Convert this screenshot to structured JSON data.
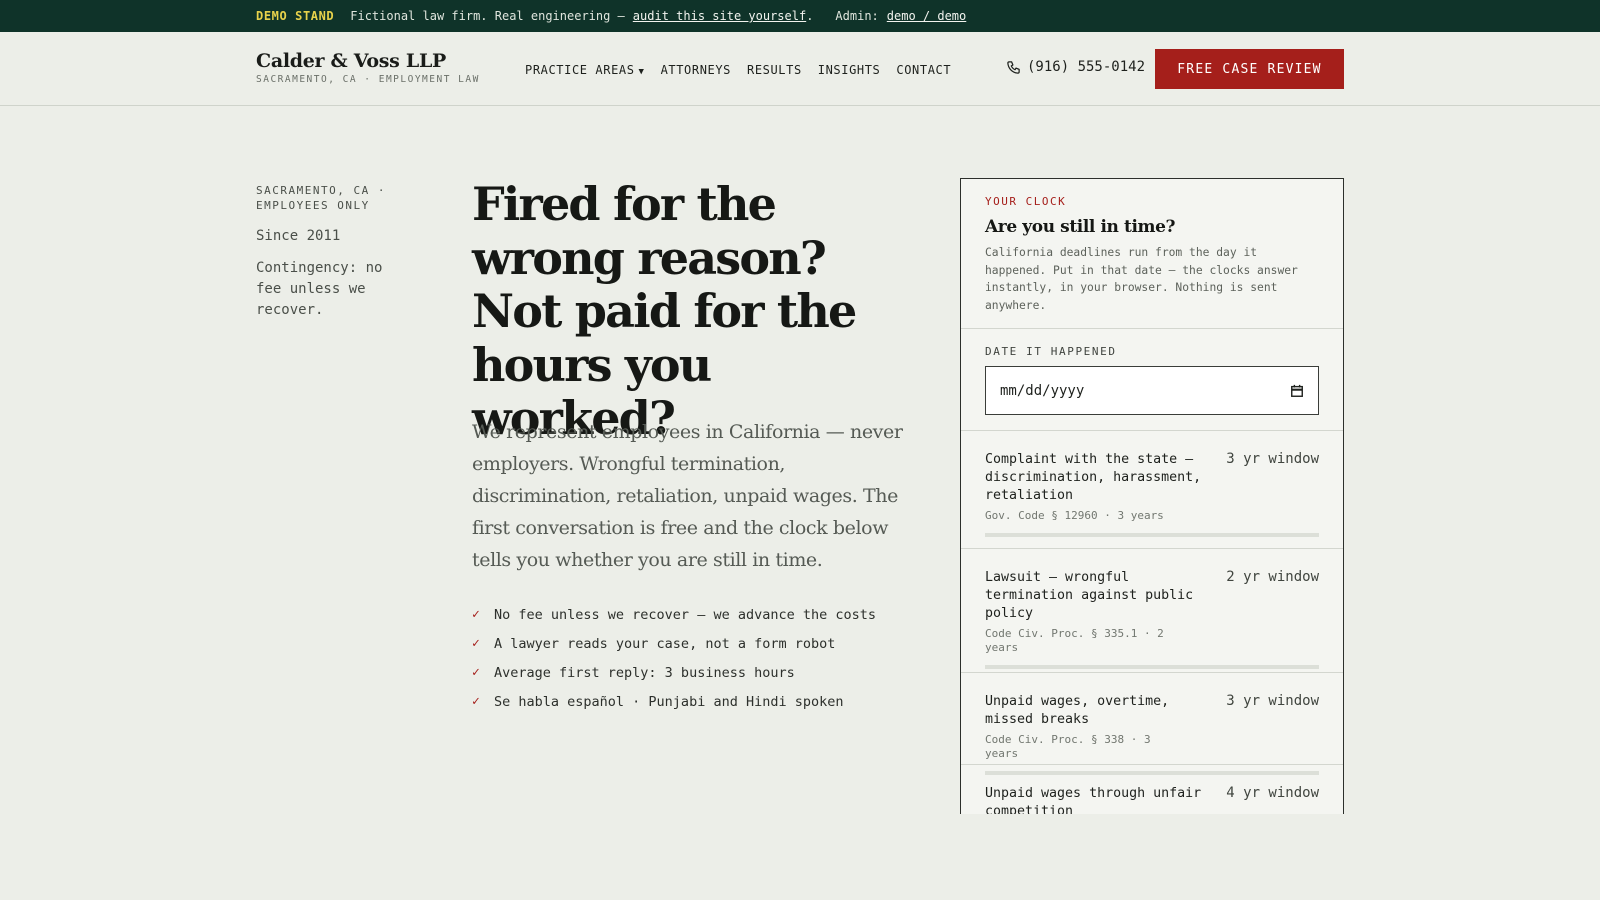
{
  "demo_bar": {
    "tag": "DEMO STAND",
    "text": "Fictional law firm. Real engineering —",
    "audit_link": "audit this site yourself",
    "period": ".",
    "admin_label": "Admin:",
    "admin_link": "demo / demo"
  },
  "header": {
    "brand_name": "Calder & Voss LLP",
    "brand_sub": "SACRAMENTO, CA · EMPLOYMENT LAW",
    "nav": {
      "practice_areas": "PRACTICE AREAS",
      "attorneys": "ATTORNEYS",
      "results": "RESULTS",
      "insights": "INSIGHTS",
      "contact": "CONTACT"
    },
    "phone": "(916) 555-0142",
    "cta": "FREE CASE REVIEW"
  },
  "meta": {
    "location_line1": "SACRAMENTO, CA ·",
    "location_line2": "EMPLOYEES ONLY",
    "since": "Since 2011",
    "fee": "Contingency: no fee unless we recover."
  },
  "hero": {
    "title": "Fired for the wrong reason? Not paid for the hours you worked?",
    "lead": "We represent employees in California — never employers. Wrongful termination, discrimination, retaliation, unpaid wages. The first conversation is free and the clock below tells you whether you are still in time.",
    "checks": [
      "No fee unless we recover — we advance the costs",
      "A lawyer reads your case, not a form robot",
      "Average first reply: 3 business hours",
      "Se habla español · Punjabi and Hindi spoken"
    ]
  },
  "clock": {
    "kicker": "YOUR CLOCK",
    "title": "Are you still in time?",
    "desc": "California deadlines run from the day it happened. Put in that date — the clocks answer instantly, in your browser. Nothing is sent anywhere.",
    "date_label": "DATE IT HAPPENED",
    "date_placeholder": "mm/dd/yyyy",
    "deadlines": [
      {
        "title": "Complaint with the state — discrimination, harassment, retaliation",
        "window": "3 yr window",
        "cite": "Gov. Code § 12960 · 3 years"
      },
      {
        "title": "Lawsuit — wrongful termination against public policy",
        "window": "2 yr window",
        "cite": "Code Civ. Proc. § 335.1 · 2 years"
      },
      {
        "title": "Unpaid wages, overtime, missed breaks",
        "window": "3 yr window",
        "cite": "Code Civ. Proc. § 338 · 3 years"
      },
      {
        "title": "Unpaid wages through unfair competition",
        "window": "4 yr window",
        "cite": ""
      }
    ]
  },
  "colors": {
    "demo_bar_bg": "#0f3329",
    "accent_red": "#a51f1b",
    "page_bg": "#eceee8"
  }
}
